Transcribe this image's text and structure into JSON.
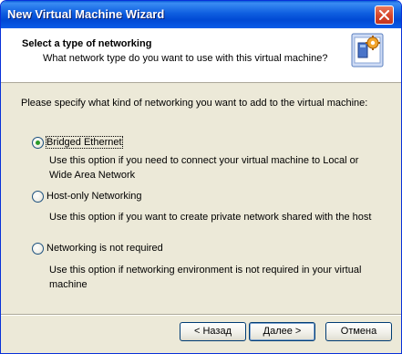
{
  "window": {
    "title": "New Virtual Machine Wizard"
  },
  "header": {
    "title": "Select a type of networking",
    "subtitle": "What network type do you want to use with this virtual machine?"
  },
  "body": {
    "prompt": "Please specify what kind of networking you want to add to the virtual machine:",
    "options": [
      {
        "label": "Bridged Ethernet",
        "checked": true,
        "description": "Use this option if you need to connect your virtual machine to Local or Wide Area Network"
      },
      {
        "label": "Host-only Networking",
        "checked": false,
        "description": "Use this option if you want to create private network shared with the host"
      },
      {
        "label": "Networking is not required",
        "checked": false,
        "description": "Use this option if networking environment is not required in your virtual machine"
      }
    ]
  },
  "buttons": {
    "back": "< Назад",
    "next": "Далее >",
    "cancel": "Отмена"
  },
  "colors": {
    "titlebar": "#0054e3",
    "dialog_bg": "#ece9d8",
    "close_button": "#d6452a"
  },
  "icons": {
    "close": "close-icon",
    "wizard": "wizard-gear-icon"
  }
}
